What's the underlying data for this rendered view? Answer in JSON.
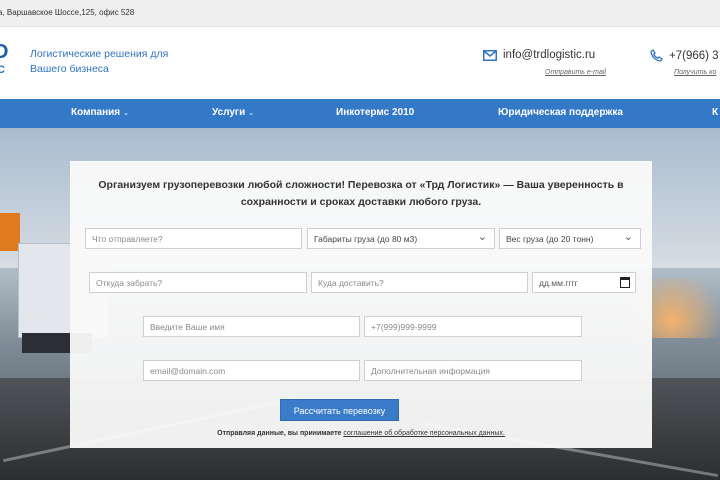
{
  "topbar": {
    "address": "а, Варшавское Шоссе,125, офис 528"
  },
  "logo": {
    "line1": "D",
    "line2": "IC"
  },
  "header": {
    "tagline": "Логистические решения для Вашего бизнеса",
    "email": {
      "value": "info@trdlogistic.ru",
      "action": "Отправить e-mail"
    },
    "phone": {
      "value": "+7(966) 3",
      "action": "Получить ко"
    }
  },
  "nav": {
    "items": [
      {
        "label": "Компания",
        "has_dropdown": true
      },
      {
        "label": "Услуги",
        "has_dropdown": true
      },
      {
        "label": "Инкотермс 2010",
        "has_dropdown": false
      },
      {
        "label": "Юридическая поддержка",
        "has_dropdown": false
      },
      {
        "label": "К",
        "has_dropdown": false
      }
    ]
  },
  "form": {
    "heading": "Организуем грузоперевозки любой сложности! Перевозка от «Трд Логистик» — Ваша уверенность в сохранности и сроках доставки любого груза.",
    "cargo_placeholder": "Что отправляете?",
    "dimensions_select": "Габариты груза (до 80 м3)",
    "weight_select": "Вес груза (до 20 тонн)",
    "from_placeholder": "Откуда забрать?",
    "to_placeholder": "Куда доставить?",
    "date_placeholder": "дд.мм.гггг",
    "name_placeholder": "Введите Ваше имя",
    "phone_placeholder": "+7(999)999-9999",
    "email_placeholder": "email@domain.com",
    "info_placeholder": "Дополнительная информация",
    "submit_label": "Рассчитать перевозку",
    "consent_text": "Отправляя данные, вы принимаете",
    "consent_link": "соглашение об обработке персональных данных."
  },
  "colors": {
    "nav": "#3478c8",
    "accent_text": "#2f74c0",
    "button": "#3a7cc9"
  }
}
